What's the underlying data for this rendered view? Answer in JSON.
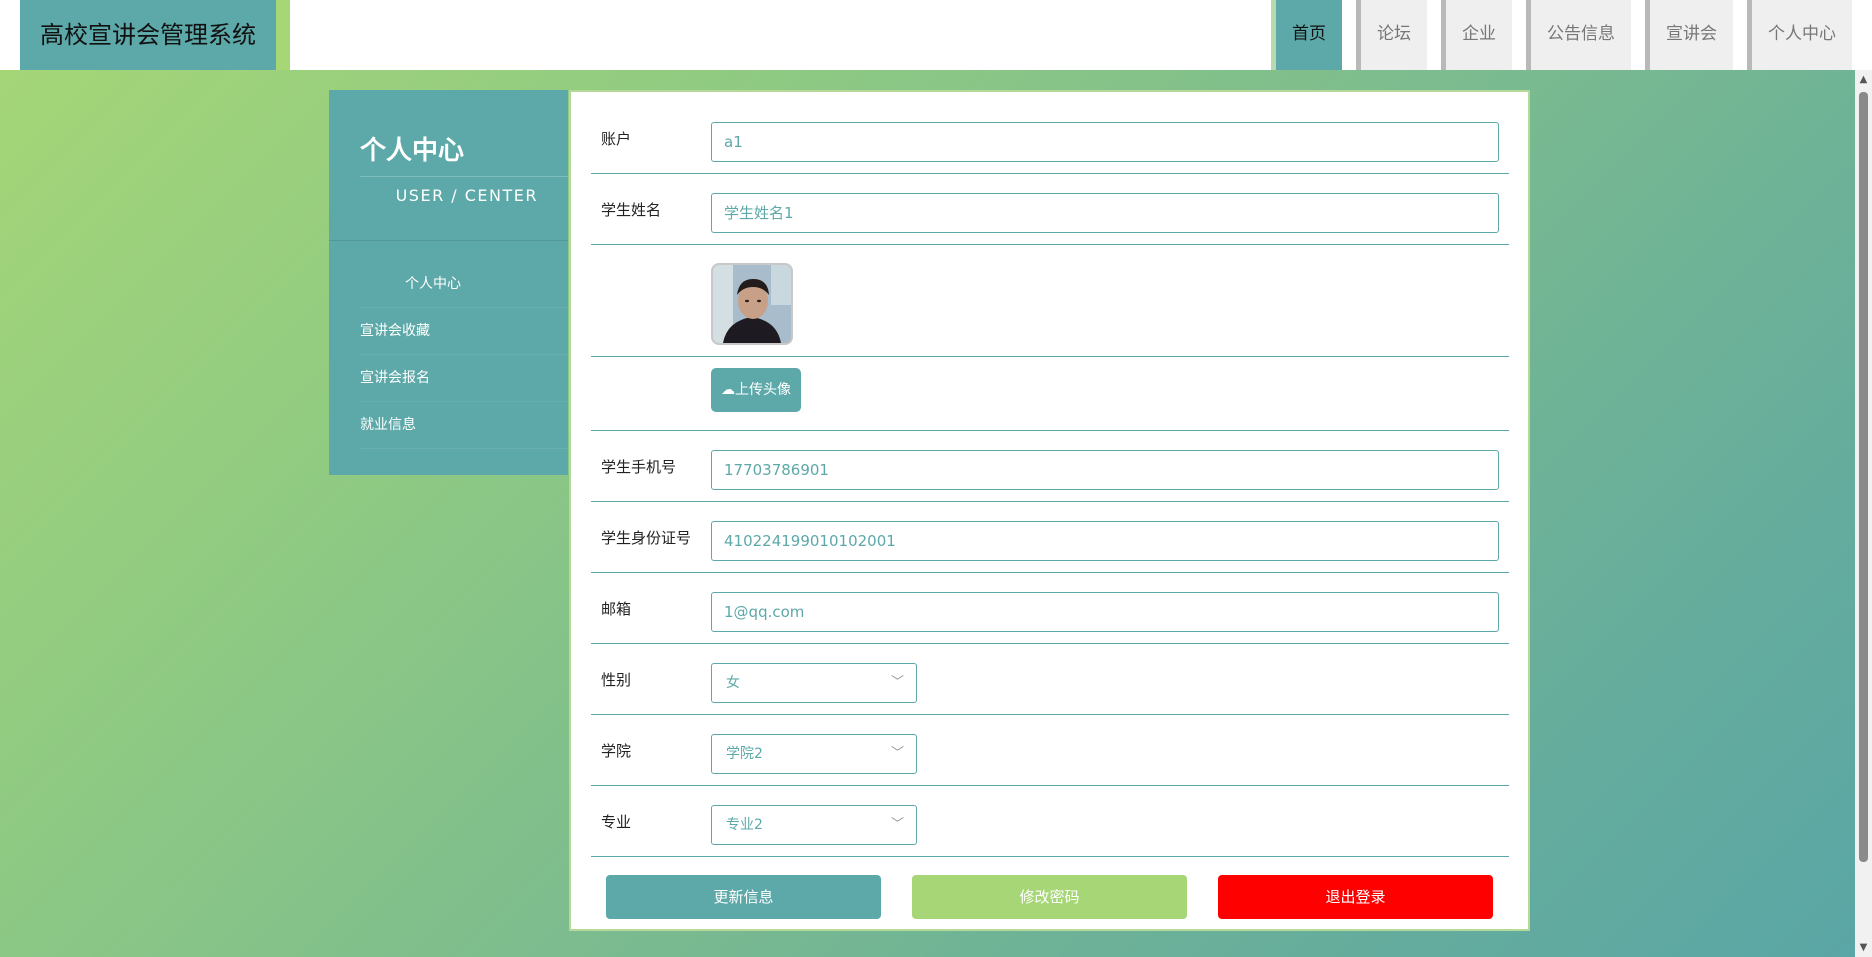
{
  "app": {
    "title": "高校宣讲会管理系统"
  },
  "nav": [
    {
      "label": "首页",
      "active": true
    },
    {
      "label": "论坛"
    },
    {
      "label": "企业"
    },
    {
      "label": "公告信息"
    },
    {
      "label": "宣讲会"
    },
    {
      "label": "个人中心"
    }
  ],
  "sidebar": {
    "title": "个人中心",
    "subtitle": "USER / CENTER",
    "items": [
      {
        "label": "个人中心",
        "active": true
      },
      {
        "label": "宣讲会收藏"
      },
      {
        "label": "宣讲会报名"
      },
      {
        "label": "就业信息"
      }
    ]
  },
  "form": {
    "account_label": "账户",
    "account_value": "a1",
    "name_label": "学生姓名",
    "name_value": "学生姓名1",
    "upload_label": "上传头像",
    "phone_label": "学生手机号",
    "phone_value": "17703786901",
    "idcard_label": "学生身份证号",
    "idcard_value": "410224199010102001",
    "email_label": "邮箱",
    "email_value": "1@qq.com",
    "gender_label": "性别",
    "gender_value": "女",
    "college_label": "学院",
    "college_value": "学院2",
    "major_label": "专业",
    "major_value": "专业2"
  },
  "buttons": {
    "update": "更新信息",
    "change_password": "修改密码",
    "logout": "退出登录"
  },
  "colors": {
    "primary": "#5da8a8",
    "secondary": "#a6d676",
    "danger": "#ff0000"
  },
  "icons": {
    "upload": "cloud-upload-icon",
    "select": "chevron-down-icon"
  }
}
